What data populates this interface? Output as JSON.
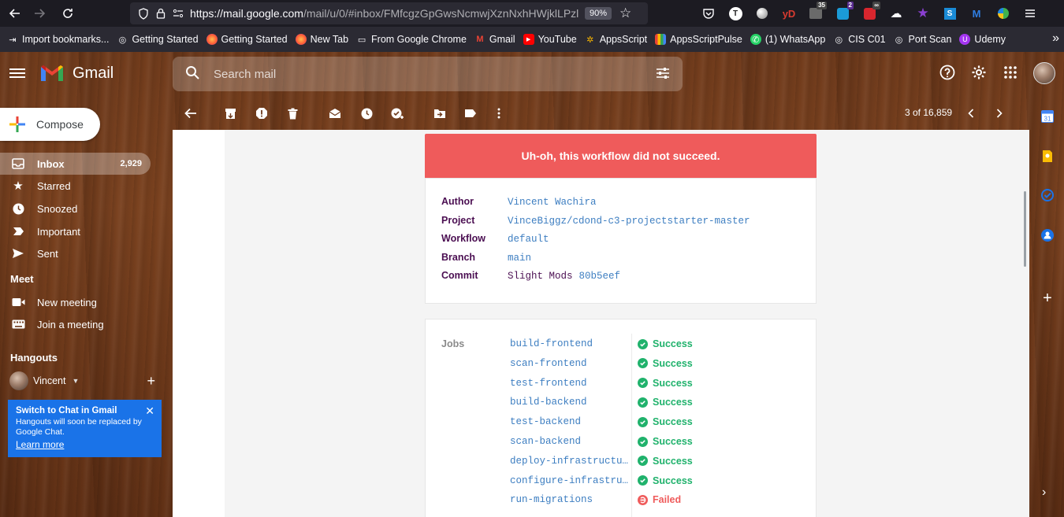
{
  "browser": {
    "url_host": "https://mail.google.com",
    "url_path": "/mail/u/0/#inbox/FMfcgzGpGwsNcmwjXznNxhHWjklLPzl",
    "zoom": "90%",
    "extensions": [
      {
        "name": "pocket",
        "badge": ""
      },
      {
        "name": "t-ext",
        "badge": ""
      },
      {
        "name": "cursor-ext",
        "badge": ""
      },
      {
        "name": "yd-ext",
        "badge": ""
      },
      {
        "name": "ext-35",
        "badge": "35"
      },
      {
        "name": "ext-2",
        "badge": "2"
      },
      {
        "name": "ext-inf",
        "badge": "∞"
      },
      {
        "name": "ext-cloud",
        "badge": ""
      },
      {
        "name": "ext-purple",
        "badge": ""
      },
      {
        "name": "ext-s",
        "badge": ""
      },
      {
        "name": "ext-m",
        "badge": ""
      },
      {
        "name": "ext-leaf",
        "badge": ""
      }
    ],
    "bookmarks": [
      "Import bookmarks...",
      "Getting Started",
      "Getting Started",
      "New Tab",
      "From Google Chrome",
      "Gmail",
      "YouTube",
      "AppsScript",
      "AppsScriptPulse",
      "(1) WhatsApp",
      "CIS C01",
      "Port Scan",
      "Udemy"
    ]
  },
  "gmail": {
    "brand": "Gmail",
    "search_placeholder": "Search mail",
    "compose_label": "Compose",
    "nav": [
      {
        "label": "Inbox",
        "count": "2,929",
        "icon": "inbox-icon"
      },
      {
        "label": "Starred",
        "count": "",
        "icon": "star-icon"
      },
      {
        "label": "Snoozed",
        "count": "",
        "icon": "clock-icon"
      },
      {
        "label": "Important",
        "count": "",
        "icon": "important-icon"
      },
      {
        "label": "Sent",
        "count": "",
        "icon": "send-icon"
      }
    ],
    "meet_title": "Meet",
    "meet_items": [
      {
        "label": "New meeting",
        "icon": "video-icon"
      },
      {
        "label": "Join a meeting",
        "icon": "keyboard-icon"
      }
    ],
    "hangouts_title": "Hangouts",
    "hangouts_user": "Vincent",
    "chat_promo": {
      "title": "Switch to Chat in Gmail",
      "body": "Hangouts will soon be replaced by Google Chat.",
      "link": "Learn more"
    },
    "pager": "3 of 16,859"
  },
  "email": {
    "alert": "Uh-oh, this workflow did not succeed.",
    "details": {
      "author_label": "Author",
      "author": "Vincent Wachira",
      "project_label": "Project",
      "project": "VinceBiggz/cdond-c3-projectstarter-master",
      "workflow_label": "Workflow",
      "workflow": "default",
      "branch_label": "Branch",
      "branch": "main",
      "commit_label": "Commit",
      "commit_msg": "Slight Mods",
      "commit_hash": "80b5eef"
    },
    "jobs_label": "Jobs",
    "jobs": [
      {
        "name": "build-frontend",
        "status": "Success"
      },
      {
        "name": "scan-frontend",
        "status": "Success"
      },
      {
        "name": "test-frontend",
        "status": "Success"
      },
      {
        "name": "build-backend",
        "status": "Success"
      },
      {
        "name": "test-backend",
        "status": "Success"
      },
      {
        "name": "scan-backend",
        "status": "Success"
      },
      {
        "name": "deploy-infrastructure",
        "status": "Success"
      },
      {
        "name": "configure-infrastructure",
        "status": "Success"
      },
      {
        "name": "run-migrations",
        "status": "Failed"
      }
    ]
  },
  "colors": {
    "alert_red": "#ef5b5b",
    "success_green": "#20b26c",
    "link_blue": "#3d7ec1",
    "label_purple": "#4b0f52",
    "promo_blue": "#1a73e8"
  }
}
